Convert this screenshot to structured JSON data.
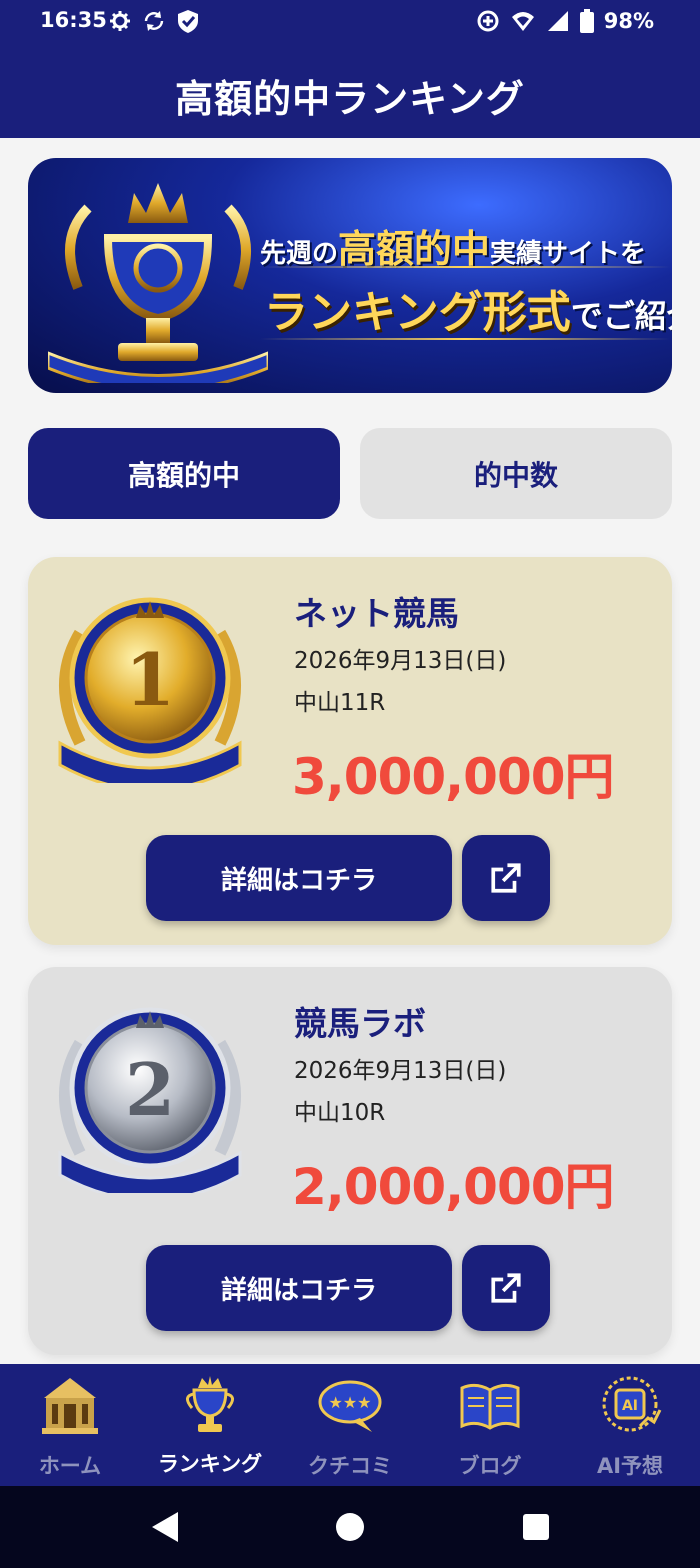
{
  "status_bar": {
    "time": "16:35",
    "battery": "98%",
    "icons_left": [
      "gear-icon",
      "sync-icon",
      "shield-icon"
    ],
    "icons_right": [
      "data-saver-icon",
      "wifi-icon",
      "signal-icon",
      "battery-icon"
    ]
  },
  "app_bar": {
    "title": "高額的中ランキング"
  },
  "banner": {
    "line1_pre": "先週の",
    "line1_highlight": "高額的中",
    "line1_post": "実績サイトを",
    "line2_highlight": "ランキング形式",
    "line2_post": "でご紹介!"
  },
  "tabs": [
    {
      "label": "高額的中",
      "active": true
    },
    {
      "label": "的中数",
      "active": false
    }
  ],
  "rankings": [
    {
      "rank": "1",
      "medal": "gold-medal",
      "site_name": "ネット競馬",
      "date": "2026年9月13日(日)",
      "race": "中山11R",
      "amount": "3,000,000円",
      "detail_label": "詳細はコチラ"
    },
    {
      "rank": "2",
      "medal": "silver-medal",
      "site_name": "競馬ラボ",
      "date": "2026年9月13日(日)",
      "race": "中山10R",
      "amount": "2,000,000円",
      "detail_label": "詳細はコチラ"
    }
  ],
  "bottom_nav": [
    {
      "label": "ホーム",
      "icon": "home-icon",
      "active": false
    },
    {
      "label": "ランキング",
      "icon": "trophy-icon",
      "active": true
    },
    {
      "label": "クチコミ",
      "icon": "review-bubble-icon",
      "active": false
    },
    {
      "label": "ブログ",
      "icon": "book-icon",
      "active": false
    },
    {
      "label": "AI予想",
      "icon": "ai-chip-icon",
      "active": false
    }
  ],
  "system_nav": [
    "back-icon",
    "home-circle-icon",
    "recents-icon"
  ],
  "colors": {
    "primary": "#1a1f7c",
    "amount": "#f04a3c",
    "card_gold_bg": "#e8e2c5",
    "card_silver_bg": "#e0e0e0",
    "gold": "#ffd75a"
  }
}
